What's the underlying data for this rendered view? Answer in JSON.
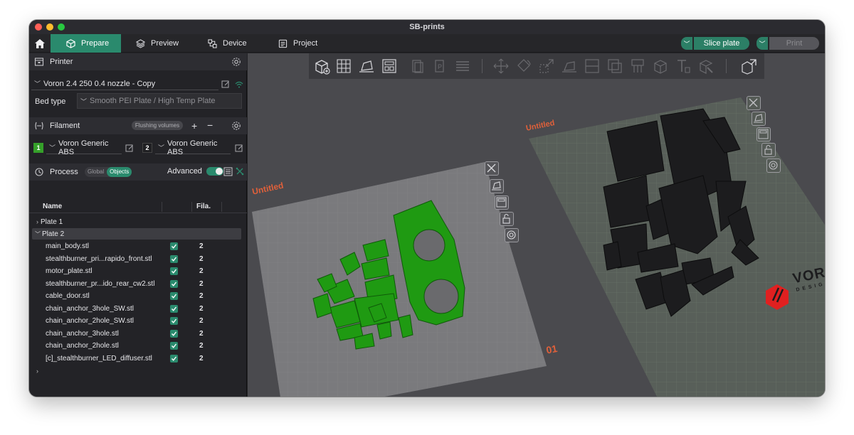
{
  "window": {
    "title": "SB-prints"
  },
  "tabs": [
    {
      "label": "Prepare",
      "icon": "cube-icon",
      "active": true
    },
    {
      "label": "Preview",
      "icon": "layers-icon",
      "active": false
    },
    {
      "label": "Device",
      "icon": "device-icon",
      "active": false
    },
    {
      "label": "Project",
      "icon": "project-icon",
      "active": false
    }
  ],
  "actions": {
    "slice_label": "Slice plate",
    "print_label": "Print"
  },
  "printer": {
    "header": "Printer",
    "selected": "Voron 2.4 250 0.4 nozzle - Copy",
    "bed_type_label": "Bed type",
    "bed_type_value": "Smooth PEI Plate / High Temp Plate"
  },
  "filament": {
    "header": "Filament",
    "flushing_label": "Flushing volumes",
    "slots": [
      {
        "num": "1",
        "name": "Voron Generic ABS",
        "color": "#35a02a"
      },
      {
        "num": "2",
        "name": "Voron Generic ABS",
        "color": "#1f1f22"
      }
    ]
  },
  "process": {
    "header": "Process",
    "global_label": "Global",
    "objects_label": "Objects",
    "advanced_label": "Advanced",
    "advanced_on": true
  },
  "objects": {
    "col_name": "Name",
    "col_fila": "Fila.",
    "plates": [
      "Plate 1",
      "Plate 2"
    ],
    "items": [
      {
        "name": "main_body.stl",
        "fila": "2"
      },
      {
        "name": "stealthburner_pri...rapido_front.stl",
        "fila": "2"
      },
      {
        "name": "motor_plate.stl",
        "fila": "2"
      },
      {
        "name": "stealthburner_pr...ido_rear_cw2.stl",
        "fila": "2"
      },
      {
        "name": "cable_door.stl",
        "fila": "2"
      },
      {
        "name": "chain_anchor_3hole_SW.stl",
        "fila": "2"
      },
      {
        "name": "chain_anchor_2hole_SW.stl",
        "fila": "2"
      },
      {
        "name": "chain_anchor_3hole.stl",
        "fila": "2"
      },
      {
        "name": "chain_anchor_2hole.stl",
        "fila": "2"
      },
      {
        "name": "[c]_stealthburner_LED_diffuser.stl",
        "fila": "2"
      }
    ]
  },
  "viewport": {
    "plate1_label": "Untitled",
    "plate2_label": "Untitled",
    "plate1_number": "01",
    "brand": "VORON",
    "brand_sub": "DESIGN",
    "accent": "#e0603a"
  },
  "colors": {
    "accent_green": "#2a8a6d",
    "part_green": "#1f9a12",
    "part_black": "#1c1c1e"
  }
}
